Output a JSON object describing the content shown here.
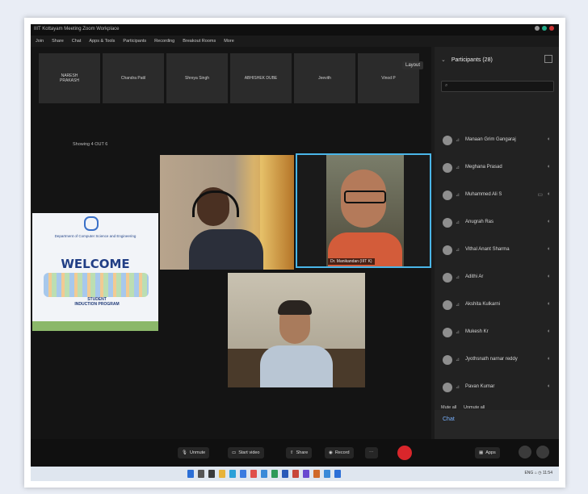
{
  "window": {
    "title": "IIIT Kottayam  Meeting   Zoom Workplace"
  },
  "menu": [
    "Join",
    "Share",
    "Chat",
    "Apps & Tools",
    "Participants",
    "Recording",
    "Breakout Rooms",
    "More"
  ],
  "thumb_strip": [
    {
      "label": "NARESH\nPRAKASH"
    },
    {
      "label": "Chandra Patil"
    },
    {
      "label": "Shreya Singh"
    },
    {
      "label": "ABHISHEK DUBE"
    },
    {
      "label": "Jeevith"
    },
    {
      "label": "Vinod P"
    }
  ],
  "layout_button": "Layout",
  "showing_text": "Showing 4 OUT 6",
  "welcome": {
    "department": "Department of Computer Science and Engineering",
    "title": "WELCOME",
    "subtitle": "STUDENT\nINDUCTION PROGRAM"
  },
  "speaker_label": "Dr. Manikandan (IIIT K)",
  "participants": {
    "header": "Participants (28)",
    "list": [
      "Manaan Grim Gangaraj",
      "Meghana Prasad",
      "Muhammed Ali S",
      "Anugrah Ras",
      "Vithal Anant Sharma",
      "Adithi Ar",
      "Akshita Kulkarni",
      "Mukesh Kr",
      "Jyothsnath narnar reddy",
      "Pavan Kumar"
    ],
    "mute_all": "Mute all",
    "unmute_all": "Unmute all"
  },
  "chat_label": "Chat",
  "controls": {
    "unmute": "Unmute",
    "start_video": "Start video",
    "share": "Share",
    "record": "Record",
    "apps": "Apps"
  },
  "tray": "ENG  ⌂  ◷  11:54",
  "colors": {
    "accent_blue": "#4ab6e8",
    "end_red": "#d9262b",
    "dark": "#141414"
  }
}
